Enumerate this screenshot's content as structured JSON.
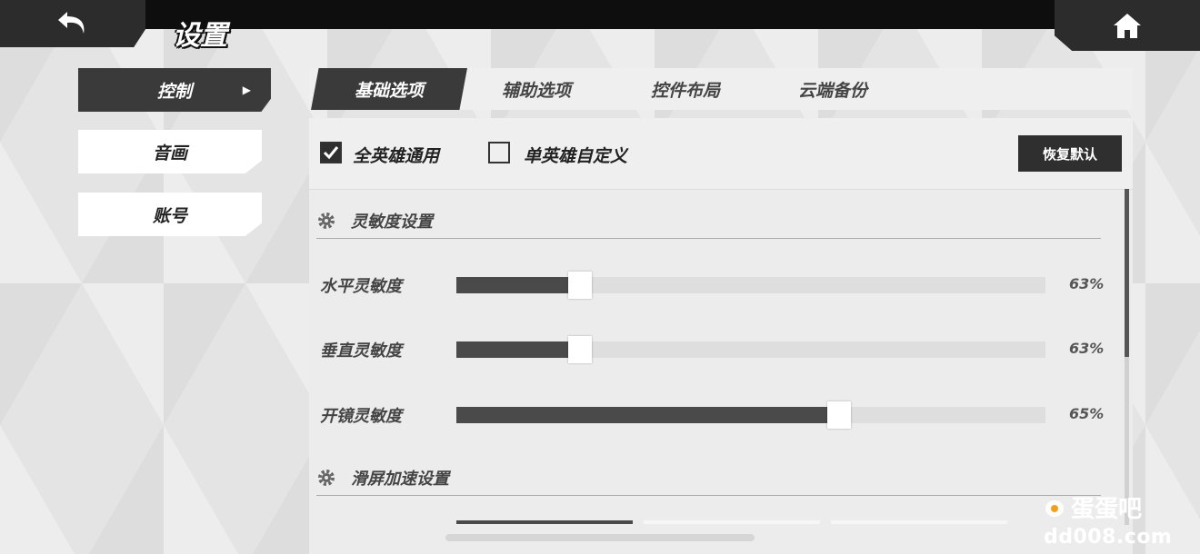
{
  "header": {
    "title": "设置",
    "back_icon": "undo-arrow-icon",
    "home_icon": "home-icon"
  },
  "sidebar": {
    "items": [
      {
        "label": "控制",
        "active": true
      },
      {
        "label": "音画",
        "active": false
      },
      {
        "label": "账号",
        "active": false
      }
    ]
  },
  "tabs": [
    {
      "label": "基础选项",
      "active": true
    },
    {
      "label": "辅助选项",
      "active": false
    },
    {
      "label": "控件布局",
      "active": false
    },
    {
      "label": "云端备份",
      "active": false
    }
  ],
  "options": {
    "all_heroes": {
      "label": "全英雄通用",
      "checked": true
    },
    "single_hero": {
      "label": "单英雄自定义",
      "checked": false
    },
    "reset_label": "恢复默认"
  },
  "sections": {
    "sensitivity": "灵敏度设置",
    "swipe_accel": "滑屏加速设置"
  },
  "sliders": [
    {
      "label": "水平灵敏度",
      "value_text": "63%",
      "level": 0.21
    },
    {
      "label": "垂直灵敏度",
      "value_text": "63%",
      "level": 0.21
    },
    {
      "label": "开镜灵敏度",
      "value_text": "65%",
      "level": 0.65
    }
  ],
  "watermark": {
    "brand": "蛋蛋吧",
    "url": "dd008.com"
  },
  "colors": {
    "dark": "#3a3a3a",
    "topbar": "#0e0e0e",
    "fill": "#4a4a4a"
  }
}
